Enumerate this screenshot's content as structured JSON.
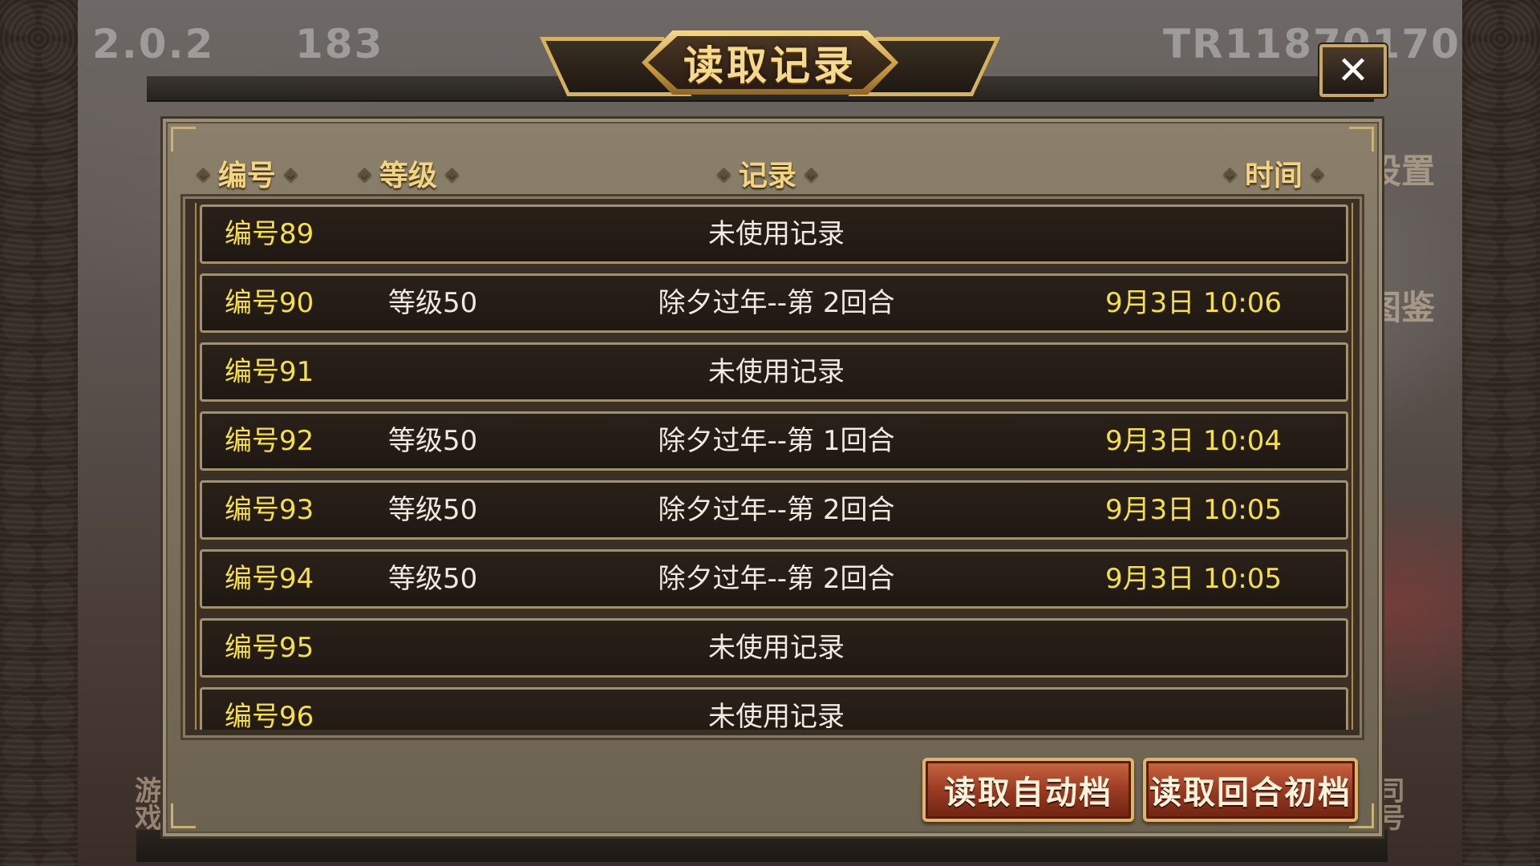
{
  "top_info": {
    "version": "2.0.2",
    "count": "183",
    "player_id": "TR11870170"
  },
  "side_labels": {
    "right_1": "设置",
    "right_2": "图鉴",
    "left_bottom": "游戏",
    "right_bottom": "司号"
  },
  "dialog": {
    "title": "读取记录",
    "close_icon": "✕",
    "headers": {
      "id": "编号",
      "level": "等级",
      "record": "记录",
      "time": "时间"
    },
    "rows": [
      {
        "id": "编号89",
        "level": "",
        "record": "未使用记录",
        "time": ""
      },
      {
        "id": "编号90",
        "level": "等级50",
        "record": "除夕过年--第 2回合",
        "time": "9月3日 10:06"
      },
      {
        "id": "编号91",
        "level": "",
        "record": "未使用记录",
        "time": ""
      },
      {
        "id": "编号92",
        "level": "等级50",
        "record": "除夕过年--第 1回合",
        "time": "9月3日 10:04"
      },
      {
        "id": "编号93",
        "level": "等级50",
        "record": "除夕过年--第 2回合",
        "time": "9月3日 10:05"
      },
      {
        "id": "编号94",
        "level": "等级50",
        "record": "除夕过年--第 2回合",
        "time": "9月3日 10:05"
      },
      {
        "id": "编号95",
        "level": "",
        "record": "未使用记录",
        "time": ""
      },
      {
        "id": "编号96",
        "level": "",
        "record": "未使用记录",
        "time": ""
      }
    ],
    "buttons": {
      "load_auto": "读取自动档",
      "load_round": "读取回合初档"
    }
  }
}
